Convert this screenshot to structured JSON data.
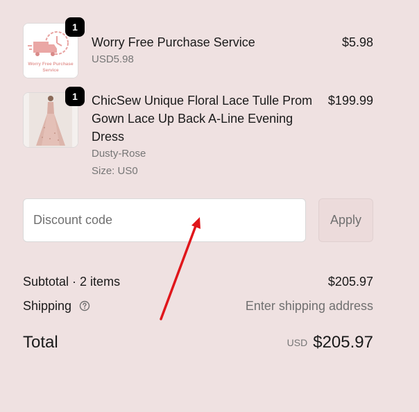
{
  "items": [
    {
      "badge": "1",
      "name": "Worry Free Purchase Service",
      "subprice": "USD5.98",
      "price": "$5.98",
      "thumb_text": "Worry Free Purchase Service"
    },
    {
      "badge": "1",
      "name": "ChicSew Unique Floral Lace Tulle Prom Gown Lace Up Back A-Line Evening Dress",
      "variant": "Dusty-Rose",
      "size": "Size: US0",
      "price": "$199.99"
    }
  ],
  "discount": {
    "placeholder": "Discount code",
    "apply_label": "Apply"
  },
  "summary": {
    "subtotal_label": "Subtotal · 2 items",
    "subtotal_value": "$205.97",
    "shipping_label": "Shipping",
    "shipping_value": "Enter shipping address",
    "total_label": "Total",
    "total_currency": "USD",
    "total_value": "$205.97"
  },
  "colors": {
    "background": "#efe1e1",
    "annotation_arrow": "#e0161b",
    "badge": "#000000"
  }
}
